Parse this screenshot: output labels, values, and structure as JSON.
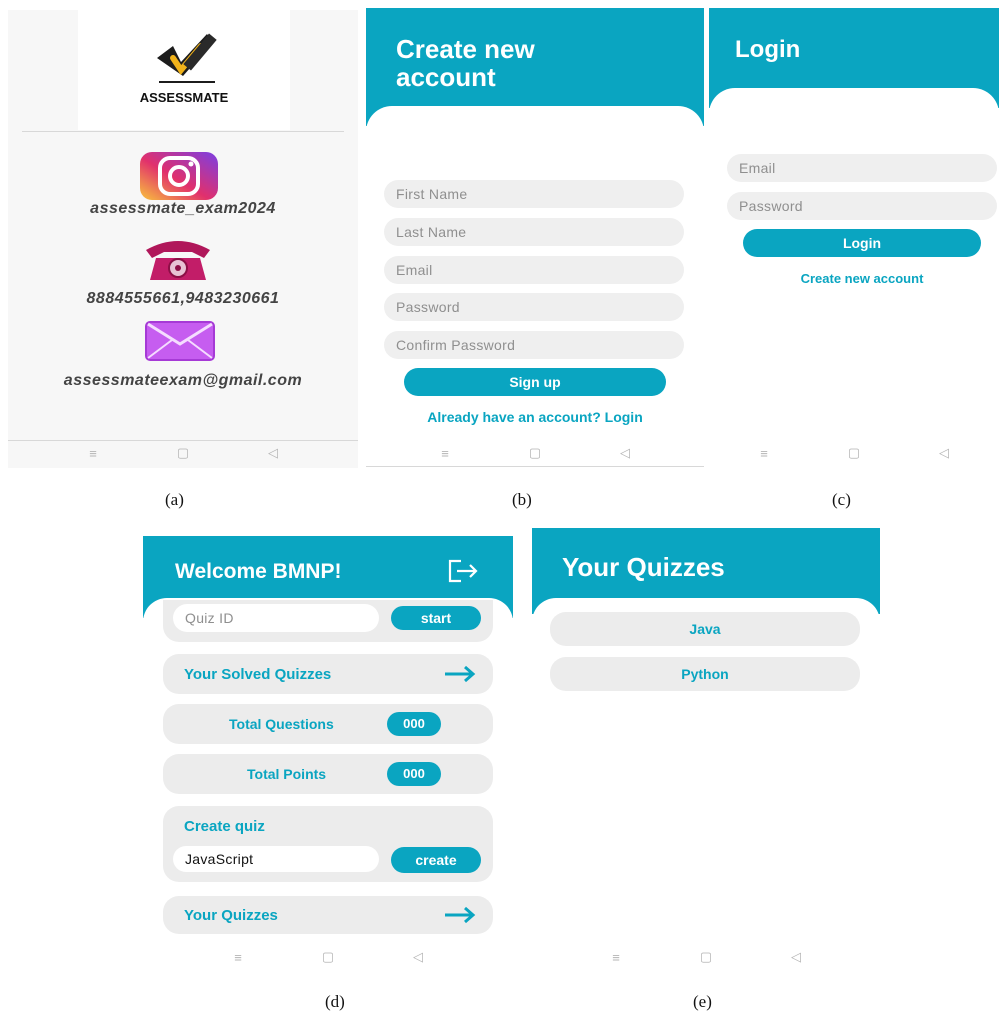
{
  "captions": [
    "(a)",
    "(b)",
    "(c)",
    "(d)",
    "(e)"
  ],
  "panel_a": {
    "logo_text": "ASSESSMATE",
    "instagram": "assessmate_exam2024",
    "phones": "8884555661,9483230661",
    "email": "assessmateexam@gmail.com"
  },
  "panel_b": {
    "title_line1": "Create new",
    "title_line2": "account",
    "first_name_placeholder": "First Name",
    "last_name_placeholder": "Last Name",
    "email_placeholder": "Email",
    "password_placeholder": "Password",
    "confirm_placeholder": "Confirm Password",
    "signup_label": "Sign up",
    "login_link": "Already have an account? Login"
  },
  "panel_c": {
    "title": "Login",
    "email_placeholder": "Email",
    "password_placeholder": "Password",
    "login_label": "Login",
    "create_link": "Create new account"
  },
  "panel_d": {
    "welcome": "Welcome BMNP!",
    "quiz_id_placeholder": "Quiz ID",
    "start_label": "start",
    "solved_label": "Your Solved Quizzes",
    "total_questions_label": "Total Questions",
    "total_questions_value": "000",
    "total_points_label": "Total Points",
    "total_points_value": "000",
    "create_quiz_heading": "Create quiz",
    "create_quiz_input": "JavaScript",
    "create_label": "create",
    "your_quizzes_label": "Your Quizzes"
  },
  "panel_e": {
    "title": "Your Quizzes",
    "quizzes": [
      "Java",
      "Python"
    ]
  },
  "navbar": {
    "menu": "≡",
    "home": "▢",
    "back": "◁"
  },
  "colors": {
    "accent": "#0aa5c1",
    "field": "#efefef",
    "panel_bg": "#f5f5f5"
  }
}
